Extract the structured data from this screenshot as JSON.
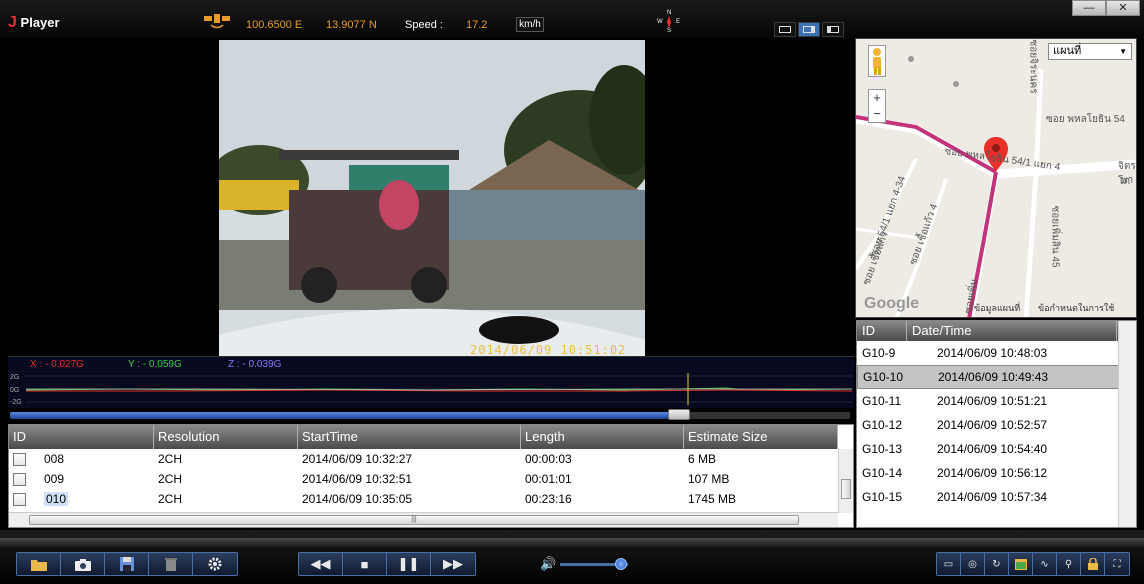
{
  "app": {
    "logo_letter": "J",
    "title": "Player"
  },
  "gps": {
    "longitude": "100.6500 E",
    "latitude": "13.9077 N",
    "speed_label": "Speed :",
    "speed_value": "17.2",
    "speed_unit": "km/h"
  },
  "compass": {
    "n": "N",
    "s": "S",
    "e": "E",
    "w": "W"
  },
  "window": {
    "minimize": "—",
    "close": "✕"
  },
  "video": {
    "timestamp": "2014/06/09  10:51:02"
  },
  "gsensor": {
    "x_label": "X : - 0.027G",
    "y_label": "Y : - 0.059G",
    "z_label": "Z : - 0.039G",
    "axis_top": "2G",
    "axis_mid": "0G",
    "axis_bottom": "-2G",
    "colors": {
      "x": "#e8302a",
      "y": "#3fd04a",
      "z": "#7f7fff"
    }
  },
  "progress": {
    "fraction": 0.81
  },
  "files": {
    "columns": [
      "ID",
      "Resolution",
      "StartTime",
      "Length",
      "Estimate Size"
    ],
    "rows": [
      {
        "id": "008",
        "resolution": "2CH",
        "start": "2014/06/09 10:32:27",
        "length": "00:00:03",
        "size": "6 MB"
      },
      {
        "id": "009",
        "resolution": "2CH",
        "start": "2014/06/09 10:32:51",
        "length": "00:01:01",
        "size": "107 MB"
      },
      {
        "id": "010",
        "resolution": "2CH",
        "start": "2014/06/09 10:35:05",
        "length": "00:23:16",
        "size": "1745 MB"
      }
    ]
  },
  "map": {
    "type_select": "แผนที่",
    "zoom_in": "+",
    "zoom_out": "−",
    "credit_data": "ข้อมูลแผนที่",
    "credit_terms": "ข้อกำหนดในการใช้",
    "google": "Google",
    "road_labels": [
      "ซอย พหลโยธิน 54/1 แยก 4",
      "ซอย พหลโยธิน 54",
      "จิตรโภ",
      "พา",
      "ซอยจิระนคร",
      "ซอยเพิ่มสิน 45",
      "ซอย 54/1 แยก 4-34",
      "ซอย เชื้อแก้ว 4",
      "ซอย เชื้อแก้ว",
      "ซอยเพิ่ม"
    ]
  },
  "events": {
    "columns": [
      "ID",
      "Date/Time"
    ],
    "rows": [
      {
        "id": "G10-9",
        "datetime": "2014/06/09  10:48:03"
      },
      {
        "id": "G10-10",
        "datetime": "2014/06/09  10:49:43"
      },
      {
        "id": "G10-11",
        "datetime": "2014/06/09  10:51:21"
      },
      {
        "id": "G10-12",
        "datetime": "2014/06/09  10:52:57"
      },
      {
        "id": "G10-13",
        "datetime": "2014/06/09  10:54:40"
      },
      {
        "id": "G10-14",
        "datetime": "2014/06/09  10:56:12"
      },
      {
        "id": "G10-15",
        "datetime": "2014/06/09  10:57:34"
      }
    ],
    "selected_index": 1
  },
  "controls": {
    "icons_left": [
      "folder-icon",
      "camera-icon",
      "save-icon",
      "trash-icon",
      "gear-icon"
    ],
    "playback": {
      "rewind": "◀◀",
      "stop": "■",
      "pause": "❚❚",
      "forward": "▶▶"
    },
    "volume": {
      "icon": "🔊",
      "level": 0.92
    },
    "icons_right": [
      "screen-icon",
      "gsensor-icon",
      "rotate-icon",
      "calendar-icon",
      "wave-icon",
      "zoom-icon",
      "lock-icon",
      "fullscreen-icon"
    ]
  }
}
